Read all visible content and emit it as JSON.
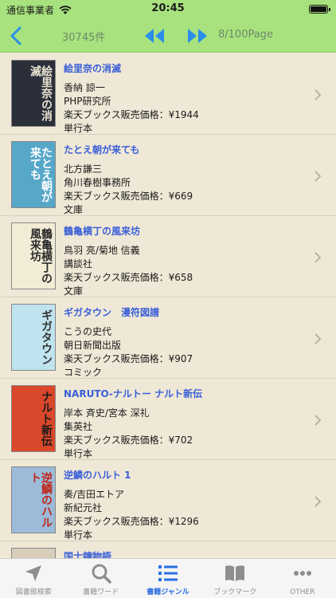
{
  "status": {
    "carrier": "通信事業者",
    "time": "20:45"
  },
  "nav": {
    "count": "30745件",
    "page": "8/100Page"
  },
  "books": [
    {
      "title": "絵里奈の消滅",
      "lines": [
        "香納 諒一",
        "PHP研究所",
        "楽天ブックス販売価格：¥1944",
        "単行本"
      ],
      "cover_text": "絵里奈の消滅",
      "cover_color": "#2a2f3a",
      "cover_text_color": "#e8e2d0"
    },
    {
      "title": "たとえ朝が来ても",
      "lines": [
        "北方謙三",
        "角川春樹事務所",
        "楽天ブックス販売価格：¥669",
        "文庫"
      ],
      "cover_text": "たとえ朝が来ても",
      "cover_color": "#57a7c9",
      "cover_text_color": "#ffffff"
    },
    {
      "title": "鶴亀横丁の風来坊",
      "lines": [
        "鳥羽 亮/菊地 信義",
        "講談社",
        "楽天ブックス販売価格：¥658",
        "文庫"
      ],
      "cover_text": "鶴亀横丁の風来坊",
      "cover_color": "#f2ecd6",
      "cover_text_color": "#2a2a2a"
    },
    {
      "title": "ギガタウン　漫符図譜",
      "lines": [
        "こうの史代",
        "朝日新聞出版",
        "楽天ブックス販売価格：¥907",
        "コミック"
      ],
      "cover_text": "ギガタウン",
      "cover_color": "#bfe3ef",
      "cover_text_color": "#333333"
    },
    {
      "title": "NARUTO-ナルトー ナルト新伝",
      "lines": [
        "岸本 斉史/宮本 深礼",
        "集英社",
        "楽天ブックス販売価格：¥702",
        "単行本"
      ],
      "cover_text": "ナルト新伝",
      "cover_color": "#d9482b",
      "cover_text_color": "#1a1a1a"
    },
    {
      "title": "逆鱗のハルト 1",
      "lines": [
        "奏/吉田エトア",
        "新紀元社",
        "楽天ブックス販売価格：¥1296",
        "単行本"
      ],
      "cover_text": "逆鱗のハルト",
      "cover_color": "#9bbbd8",
      "cover_text_color": "#c0261a"
    },
    {
      "title": "国士鐘物語",
      "lines": [],
      "cover_text": "",
      "cover_color": "#d8cdb8",
      "cover_text_color": "#333333"
    }
  ],
  "tabs": [
    {
      "label": "図書館検索",
      "icon": "location-arrow-icon"
    },
    {
      "label": "書籍ワード",
      "icon": "search-icon"
    },
    {
      "label": "書籍ジャンル",
      "icon": "list-icon"
    },
    {
      "label": "ブックマーク",
      "icon": "book-icon"
    },
    {
      "label": "OTHER",
      "icon": "more-icon"
    }
  ],
  "colors": {
    "accent": "#3a5fd8",
    "bar": "#a8e27e",
    "nav_arrows": "#2a8ee8",
    "active_tab": "#2a6fe0"
  }
}
